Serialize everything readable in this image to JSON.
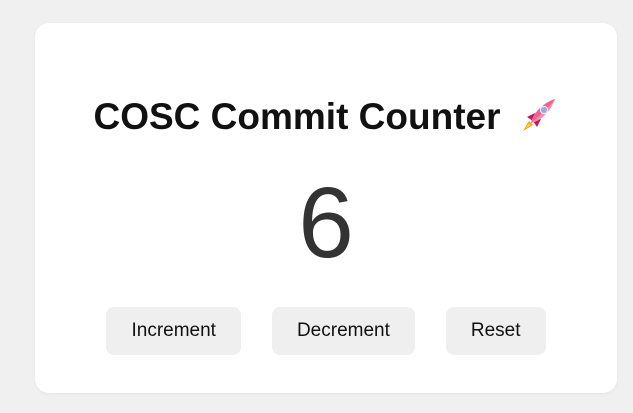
{
  "counter": {
    "title": "COSC Commit Counter",
    "title_icon": "rocket-icon",
    "value": "6"
  },
  "controls": {
    "increment_label": "Increment",
    "decrement_label": "Decrement",
    "reset_label": "Reset"
  },
  "colors": {
    "page_background": "#f0f0f0",
    "card_background": "#ffffff",
    "button_background": "#efefef",
    "count_text": "#333333",
    "rocket_body": "#f06292",
    "rocket_window": "#9fa8da",
    "rocket_flame": "#ff9800"
  }
}
